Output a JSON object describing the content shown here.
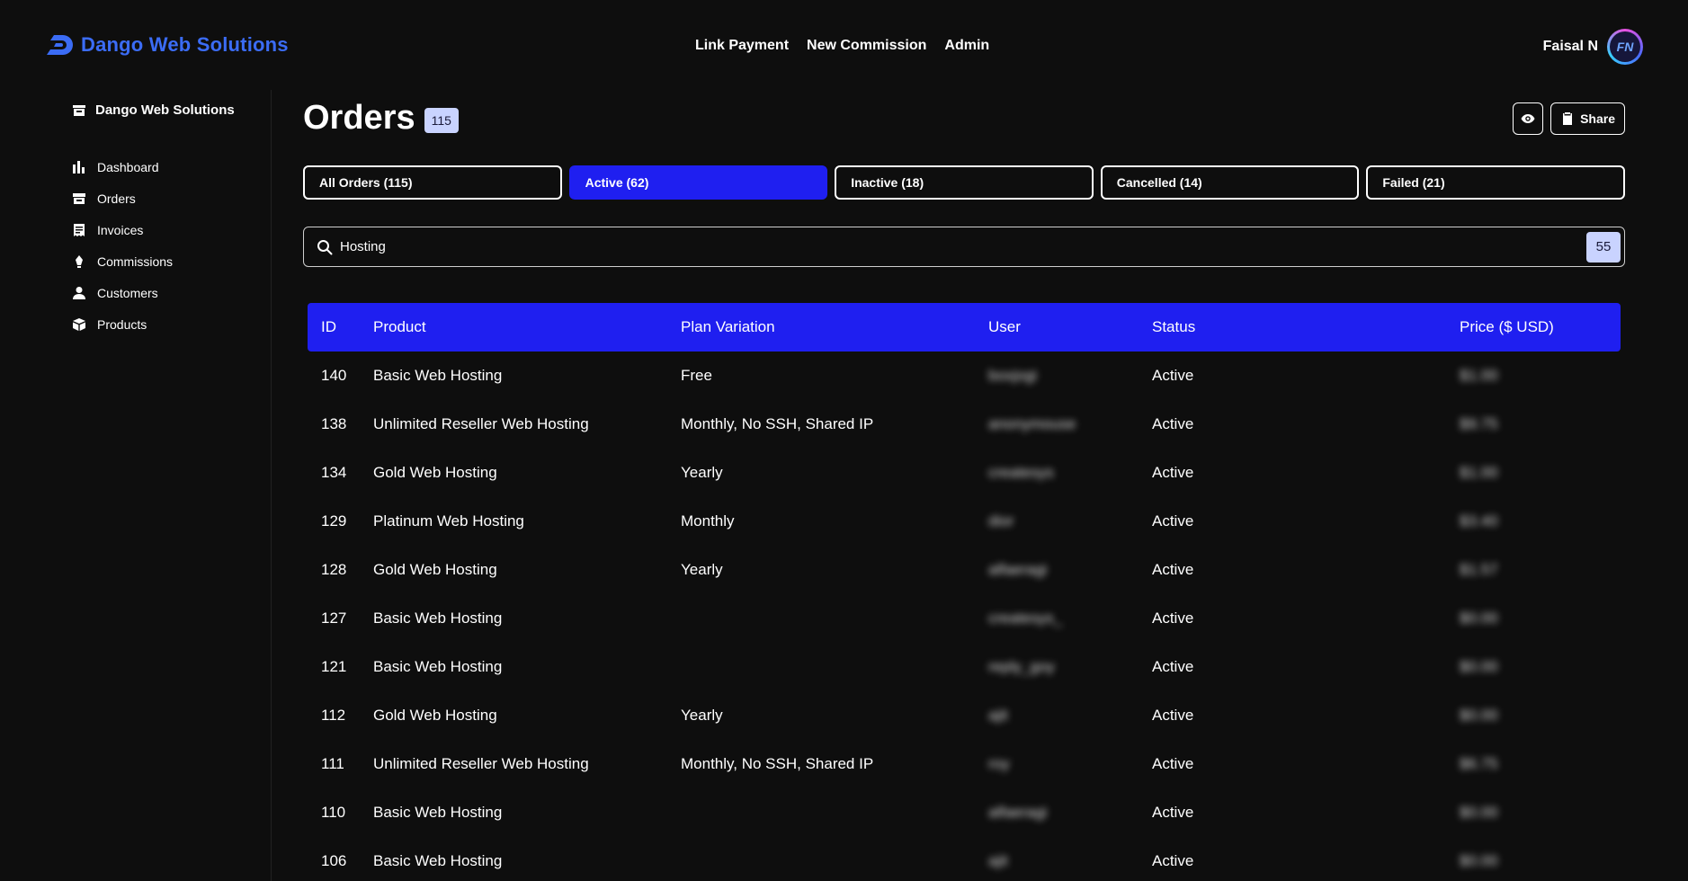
{
  "brand": {
    "name": "Dango Web Solutions",
    "color": "#3b6cf5"
  },
  "topnav": [
    {
      "label": "Link Payment"
    },
    {
      "label": "New Commission"
    },
    {
      "label": "Admin"
    }
  ],
  "user": {
    "name": "Faisal N",
    "initials": "FN"
  },
  "sidebar": {
    "org": "Dango Web Solutions",
    "items": [
      {
        "label": "Dashboard",
        "icon": "bar-chart-icon"
      },
      {
        "label": "Orders",
        "icon": "box-icon"
      },
      {
        "label": "Invoices",
        "icon": "receipt-icon"
      },
      {
        "label": "Commissions",
        "icon": "pen-nib-icon"
      },
      {
        "label": "Customers",
        "icon": "user-icon"
      },
      {
        "label": "Products",
        "icon": "cube-icon"
      }
    ]
  },
  "page": {
    "title": "Orders",
    "count": "115",
    "share_label": "Share"
  },
  "tabs": [
    {
      "label": "All Orders (115)",
      "active": false
    },
    {
      "label": "Active (62)",
      "active": true
    },
    {
      "label": "Inactive (18)",
      "active": false
    },
    {
      "label": "Cancelled (14)",
      "active": false
    },
    {
      "label": "Failed (21)",
      "active": false
    }
  ],
  "search": {
    "value": "Hosting",
    "result_count": "55"
  },
  "table": {
    "headers": [
      "ID",
      "Product",
      "Plan Variation",
      "User",
      "Status",
      "Price ($ USD)"
    ],
    "rows": [
      {
        "id": "140",
        "product": "Basic Web Hosting",
        "plan": "Free",
        "user": "boxjogi",
        "status": "Active",
        "price": "$1.00"
      },
      {
        "id": "138",
        "product": "Unlimited Reseller Web Hosting",
        "plan": "Monthly, No SSH, Shared IP",
        "user": "anonymouse",
        "status": "Active",
        "price": "$9.75"
      },
      {
        "id": "134",
        "product": "Gold Web Hosting",
        "plan": "Yearly",
        "user": "createsys",
        "status": "Active",
        "price": "$1.00"
      },
      {
        "id": "129",
        "product": "Platinum Web Hosting",
        "plan": "Monthly",
        "user": "dior",
        "status": "Active",
        "price": "$3.40"
      },
      {
        "id": "128",
        "product": "Gold Web Hosting",
        "plan": "Yearly",
        "user": "alfaeragi",
        "status": "Active",
        "price": "$1.57"
      },
      {
        "id": "127",
        "product": "Basic Web Hosting",
        "plan": "",
        "user": "createsys_",
        "status": "Active",
        "price": "$0.00"
      },
      {
        "id": "121",
        "product": "Basic Web Hosting",
        "plan": "",
        "user": "reply_goy",
        "status": "Active",
        "price": "$0.00"
      },
      {
        "id": "112",
        "product": "Gold Web Hosting",
        "plan": "Yearly",
        "user": "ajit",
        "status": "Active",
        "price": "$0.00"
      },
      {
        "id": "111",
        "product": "Unlimited Reseller Web Hosting",
        "plan": "Monthly, No SSH, Shared IP",
        "user": "roy",
        "status": "Active",
        "price": "$6.75"
      },
      {
        "id": "110",
        "product": "Basic Web Hosting",
        "plan": "",
        "user": "alfaeragi",
        "status": "Active",
        "price": "$0.00"
      },
      {
        "id": "106",
        "product": "Basic Web Hosting",
        "plan": "",
        "user": "ajit",
        "status": "Active",
        "price": "$0.00"
      }
    ]
  },
  "colors": {
    "accent": "#1f1ff0",
    "background": "#0e0e0e",
    "badge": "#c9d3ff"
  }
}
